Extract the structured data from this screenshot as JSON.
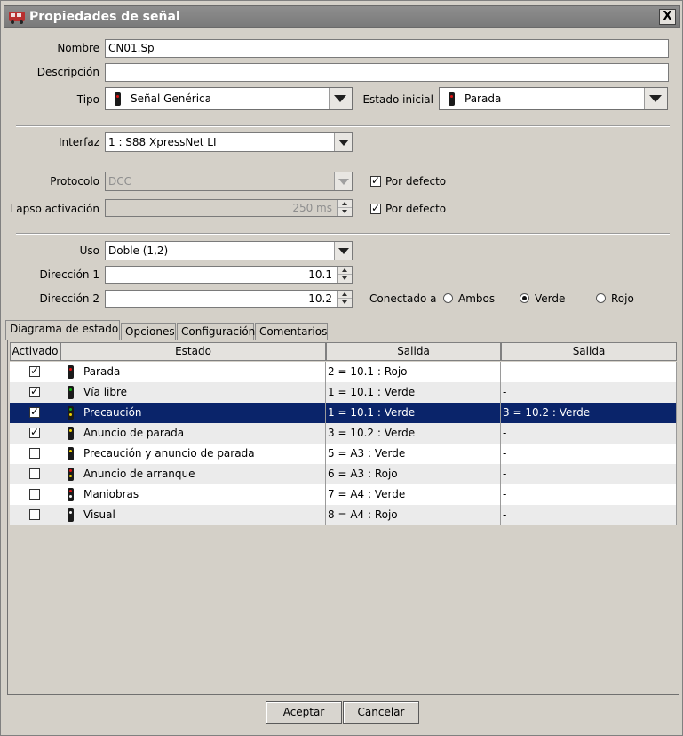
{
  "window": {
    "title": "Propiedades de señal",
    "close_label": "X"
  },
  "form": {
    "nombre_label": "Nombre",
    "nombre_value": "CN01.Sp",
    "descripcion_label": "Descripción",
    "descripcion_value": "",
    "tipo_label": "Tipo",
    "tipo_value": "Señal Genérica",
    "estado_inicial_label": "Estado inicial",
    "estado_inicial_value": "Parada",
    "interfaz_label": "Interfaz",
    "interfaz_value": "1 : S88 XpressNet LI",
    "protocolo_label": "Protocolo",
    "protocolo_value": "DCC",
    "protocolo_default_label": "Por defecto",
    "protocolo_default_checked": true,
    "lapso_label": "Lapso activación",
    "lapso_value": "250 ms",
    "lapso_default_label": "Por defecto",
    "lapso_default_checked": true,
    "uso_label": "Uso",
    "uso_value": "Doble (1,2)",
    "direccion1_label": "Dirección 1",
    "direccion1_value": "10.1",
    "direccion2_label": "Dirección 2",
    "direccion2_value": "10.2",
    "conectado_label": "Conectado a",
    "conectado_options": [
      "Ambos",
      "Verde",
      "Rojo"
    ],
    "conectado_selected": "Verde"
  },
  "tabs": [
    "Diagrama de estado",
    "Opciones",
    "Configuración",
    "Comentarios"
  ],
  "active_tab": "Diagrama de estado",
  "table": {
    "columns": [
      "Activado",
      "Estado",
      "Salida",
      "Salida"
    ],
    "rows": [
      {
        "checked": true,
        "icon": "signal-red-icon",
        "estado": "Parada",
        "salida1": "2 = 10.1 : Rojo",
        "salida2": "-"
      },
      {
        "checked": true,
        "icon": "signal-green-icon",
        "estado": "Vía libre",
        "salida1": "1 = 10.1 : Verde",
        "salida2": "-"
      },
      {
        "checked": true,
        "icon": "signal-green-yellow-icon",
        "estado": "Precaución",
        "salida1": "1 = 10.1 : Verde",
        "salida2": "3 = 10.2 : Verde"
      },
      {
        "checked": true,
        "icon": "signal-yellow-icon",
        "estado": "Anuncio de parada",
        "salida1": "3 = 10.2 : Verde",
        "salida2": "-"
      },
      {
        "checked": false,
        "icon": "signal-yellow-icon",
        "estado": "Precaución y anuncio de parada",
        "salida1": "5 = A3 : Verde",
        "salida2": "-"
      },
      {
        "checked": false,
        "icon": "signal-red-yellow-icon",
        "estado": "Anuncio de arranque",
        "salida1": "6 = A3 : Rojo",
        "salida2": "-"
      },
      {
        "checked": false,
        "icon": "signal-red-white-icon",
        "estado": "Maniobras",
        "salida1": "7 = A4 : Verde",
        "salida2": "-"
      },
      {
        "checked": false,
        "icon": "signal-white-icon",
        "estado": "Visual",
        "salida1": "8 = A4 : Rojo",
        "salida2": "-"
      }
    ],
    "selected_row": 2
  },
  "buttons": {
    "accept": "Aceptar",
    "cancel": "Cancelar"
  },
  "colors": {
    "selection": "#0a246a",
    "window_bg": "#d4d0c8",
    "titlebar": "#858585",
    "signal_red": "#e01010",
    "signal_green": "#10b010",
    "signal_yellow": "#f0d000",
    "signal_white": "#f4f4f4"
  }
}
